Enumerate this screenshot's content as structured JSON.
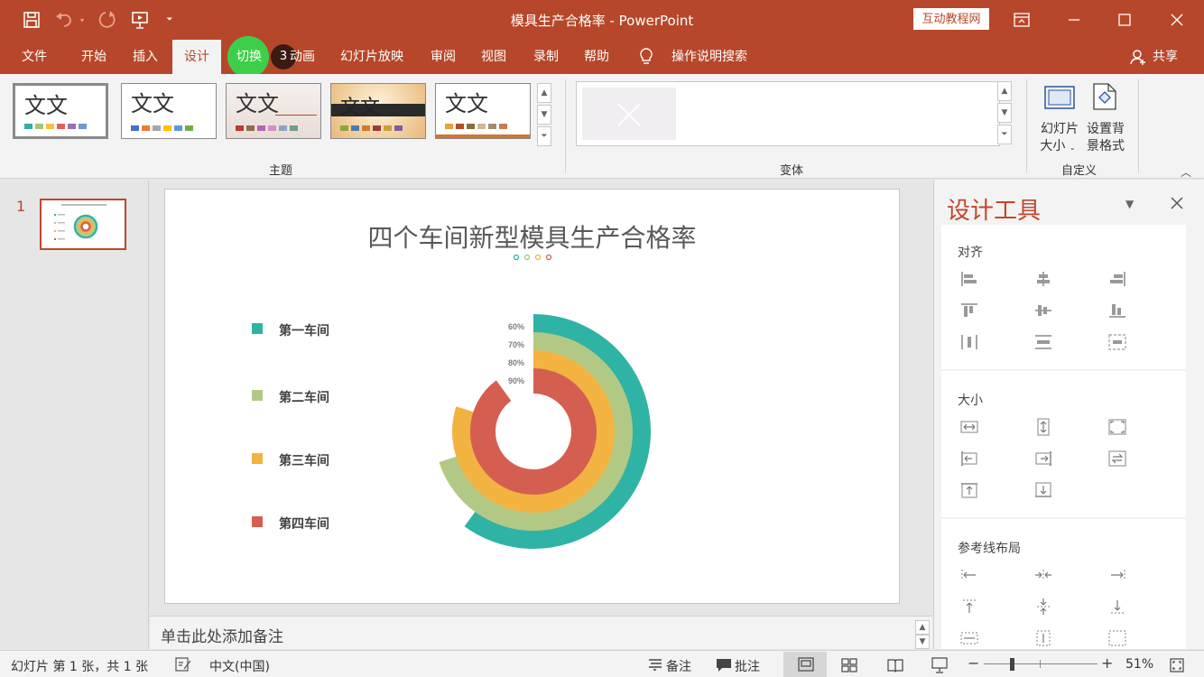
{
  "window": {
    "title": "模具生产合格率 - PowerPoint",
    "badge": "互动教程网",
    "share_label": "共享"
  },
  "tabs": [
    {
      "label": "文件"
    },
    {
      "label": "开始"
    },
    {
      "label": "插入"
    },
    {
      "label": "设计",
      "active": true
    },
    {
      "label": "切换"
    },
    {
      "label": "动画"
    },
    {
      "label": "幻灯片放映"
    },
    {
      "label": "审阅"
    },
    {
      "label": "视图"
    },
    {
      "label": "录制"
    },
    {
      "label": "帮助"
    },
    {
      "label": "操作说明搜索"
    }
  ],
  "click_marker": {
    "number": "3"
  },
  "ribbon": {
    "themes": [
      {
        "text": "文文",
        "swatches": [
          "#2fb3a5",
          "#a4c67a",
          "#f6c343",
          "#e0625a",
          "#9b6fb0",
          "#6b9bd1"
        ]
      },
      {
        "text": "文文",
        "swatches": [
          "#4472c4",
          "#ed7d31",
          "#a5a5a5",
          "#ffc000",
          "#5b9bd5",
          "#70ad47"
        ]
      },
      {
        "text": "文文",
        "swatches": [
          "#c0392b",
          "#8e6c4f",
          "#b065b3",
          "#d48fc7",
          "#8fa3c4",
          "#6d9d8e"
        ]
      },
      {
        "text": "文文",
        "swatches": [
          "#8da63b",
          "#4b7ab0",
          "#d07b2b",
          "#9b3b3b",
          "#c9a13b",
          "#7d5fa0"
        ]
      },
      {
        "text": "文文",
        "swatches": [
          "#e8a13b",
          "#b94a2f",
          "#8a6d3b",
          "#d9b48f",
          "#a58b6e",
          "#c97d4f"
        ]
      }
    ],
    "group_themes": "主题",
    "group_variants": "变体",
    "group_customize": "自定义",
    "btn_slide_size": [
      "幻灯片",
      "大小"
    ],
    "btn_bg_format": [
      "设置背",
      "景格式"
    ]
  },
  "thumbnails": [
    {
      "number": "1"
    }
  ],
  "slide": {
    "title": "四个车间新型模具生产合格率",
    "dot_colors": [
      "#2fb3a5",
      "#a4c67a",
      "#f2b340",
      "#d45f50"
    ],
    "legend": [
      {
        "label": "第一车间",
        "color": "#2fb3a5"
      },
      {
        "label": "第二车间",
        "color": "#b2c985"
      },
      {
        "label": "第三车间",
        "color": "#f2b340"
      },
      {
        "label": "第四车间",
        "color": "#d45f50"
      }
    ]
  },
  "chart_data": {
    "type": "radial-bar",
    "title": "四个车间新型模具生产合格率",
    "categories": [
      "第一车间",
      "第二车间",
      "第三车间",
      "第四车间"
    ],
    "values": [
      60,
      70,
      80,
      90
    ],
    "value_labels": [
      "60%",
      "70%",
      "80%",
      "90%"
    ],
    "unit": "%",
    "colors": [
      "#2fb3a5",
      "#b2c985",
      "#f2b340",
      "#d45f50"
    ]
  },
  "notes_placeholder": "单击此处添加备注",
  "taskpane": {
    "title": "设计工具",
    "sections": [
      {
        "title": "对齐"
      },
      {
        "title": "大小"
      },
      {
        "title": "参考线布局"
      }
    ]
  },
  "status": {
    "slide_info": "幻灯片 第 1 张，共 1 张",
    "language": "中文(中国)",
    "notes": "备注",
    "comments": "批注",
    "zoom": "51%"
  },
  "accent_color": "#b7472a"
}
